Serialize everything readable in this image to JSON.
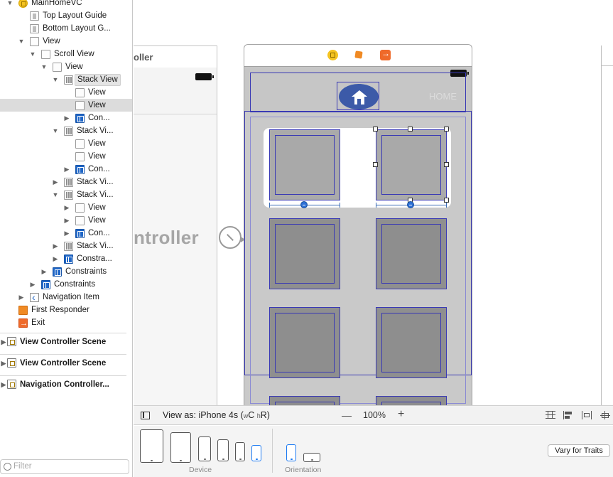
{
  "outline": {
    "items": [
      {
        "label": "MainHomeVC",
        "icon": "view-controller-icon"
      },
      {
        "label": "Top Layout Guide",
        "icon": "layout-guide-icon"
      },
      {
        "label": "Bottom Layout G...",
        "icon": "layout-guide-icon"
      },
      {
        "label": "View",
        "icon": "view-icon"
      },
      {
        "label": "Scroll View",
        "icon": "view-icon"
      },
      {
        "label": "View",
        "icon": "view-icon"
      },
      {
        "label": "Stack View",
        "icon": "stack-view-icon"
      },
      {
        "label": "View",
        "icon": "view-icon"
      },
      {
        "label": "View",
        "icon": "view-icon"
      },
      {
        "label": "Con...",
        "icon": "constraints-icon"
      },
      {
        "label": "Stack Vi...",
        "icon": "stack-view-icon"
      },
      {
        "label": "View",
        "icon": "view-icon"
      },
      {
        "label": "View",
        "icon": "view-icon"
      },
      {
        "label": "Con...",
        "icon": "constraints-icon"
      },
      {
        "label": "Stack Vi...",
        "icon": "stack-view-icon"
      },
      {
        "label": "Stack Vi...",
        "icon": "stack-view-icon"
      },
      {
        "label": "View",
        "icon": "view-icon"
      },
      {
        "label": "View",
        "icon": "view-icon"
      },
      {
        "label": "Con...",
        "icon": "constraints-icon"
      },
      {
        "label": "Stack Vi...",
        "icon": "stack-view-icon"
      },
      {
        "label": "Constra...",
        "icon": "constraints-icon"
      },
      {
        "label": "Constraints",
        "icon": "constraints-icon"
      },
      {
        "label": "Constraints",
        "icon": "constraints-icon"
      },
      {
        "label": "Navigation Item",
        "icon": "navigation-item-icon"
      },
      {
        "label": "First Responder",
        "icon": "first-responder-icon"
      },
      {
        "label": "Exit",
        "icon": "exit-icon"
      }
    ],
    "scenes": [
      "View Controller Scene",
      "View Controller Scene",
      "Navigation Controller..."
    ],
    "filter_placeholder": "Filter"
  },
  "canvas": {
    "prev_scene_title": "oller",
    "prev_scene_big_text": "ntroller",
    "faded_text": "HOME"
  },
  "bottom": {
    "view_as": "View as: iPhone 4s",
    "size_class_w": "w",
    "size_class_c": "C",
    "size_class_h": "h",
    "size_class_r": "R",
    "zoom_minus": "—",
    "zoom": "100%",
    "zoom_plus": "+",
    "device_label": "Device",
    "orientation_label": "Orientation",
    "vary_button": "Vary for Traits"
  },
  "colors": {
    "accent": "#1e7bf2",
    "constraint_blue": "#3939b4",
    "nav_button": "#3c5aa8"
  }
}
